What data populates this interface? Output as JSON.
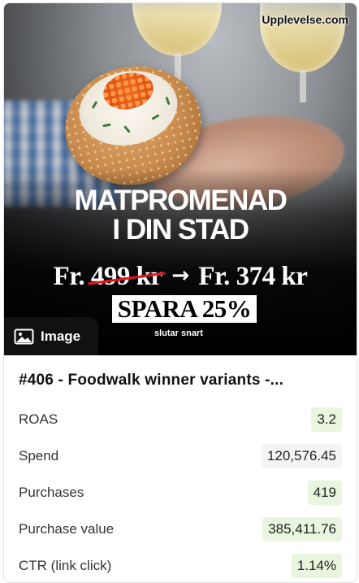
{
  "creative": {
    "brand": "Upplevelse.com",
    "headline_line1": "MATPROMENAD",
    "headline_line2": "I DIN STAD",
    "price_prefix_old": "Fr.",
    "price_old": "499 kr",
    "price_arrow": "→",
    "price_new": "Fr. 374 kr",
    "badge": "SPARA 25%",
    "ends_text": "slutar snart",
    "media_type_label": "Image",
    "media_type_icon": "image-icon"
  },
  "ad": {
    "title": "#406 - Foodwalk winner variants -..."
  },
  "metrics": [
    {
      "label": "ROAS",
      "value": "3.2",
      "highlight": true
    },
    {
      "label": "Spend",
      "value": "120,576.45",
      "highlight": false
    },
    {
      "label": "Purchases",
      "value": "419",
      "highlight": true
    },
    {
      "label": "Purchase value",
      "value": "385,411.76",
      "highlight": true
    },
    {
      "label": "CTR (link click)",
      "value": "1.14%",
      "highlight": true
    }
  ],
  "colors": {
    "highlight_bg": "#e8f6df",
    "neutral_bg": "#f4f4f4",
    "strike_red": "#e4161d"
  }
}
